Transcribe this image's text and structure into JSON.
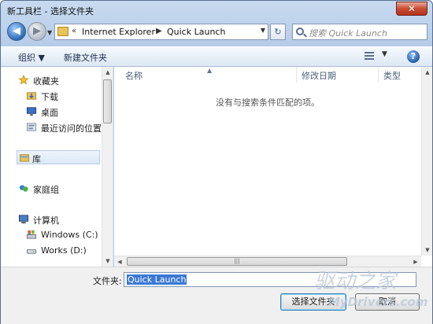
{
  "window": {
    "title": "新工具栏 - 选择文件夹",
    "close": "✕"
  },
  "nav": {
    "back": "◀",
    "forward": "▶",
    "history": "▼",
    "address": {
      "prefix": "«",
      "crumbs": [
        "Internet Explorer",
        "Quick Launch"
      ],
      "separator": "▶",
      "dropdown": "▼"
    },
    "refresh": "↻",
    "search_placeholder": "搜索 Quick Launch"
  },
  "toolbar": {
    "organize": "组织 ▼",
    "new_folder": "新建文件夹",
    "view_caret": "▼",
    "help": "?"
  },
  "sidebar": {
    "items": [
      {
        "label": "收藏夹",
        "icon": "star-icon"
      },
      {
        "label": "下载",
        "icon": "download-folder-icon"
      },
      {
        "label": "桌面",
        "icon": "desktop-icon"
      },
      {
        "label": "最近访问的位置",
        "icon": "recent-places-icon"
      },
      {
        "label": "库",
        "icon": "library-icon",
        "selected": true
      },
      {
        "label": "家庭组",
        "icon": "homegroup-icon"
      },
      {
        "label": "计算机",
        "icon": "computer-icon"
      },
      {
        "label": "Windows (C:)",
        "icon": "drive-c-icon"
      },
      {
        "label": "Works (D:)",
        "icon": "drive-d-icon"
      }
    ]
  },
  "content": {
    "columns": [
      "名称",
      "修改日期",
      "类型"
    ],
    "empty_message": "没有与搜索条件匹配的项。"
  },
  "bottom": {
    "folder_label": "文件夹:",
    "folder_value": "Quick Launch",
    "select_button": "选择文件夹",
    "cancel_button": "取消"
  },
  "watermark": {
    "script": "驱动之家",
    "site": "MyDrivers.com"
  }
}
